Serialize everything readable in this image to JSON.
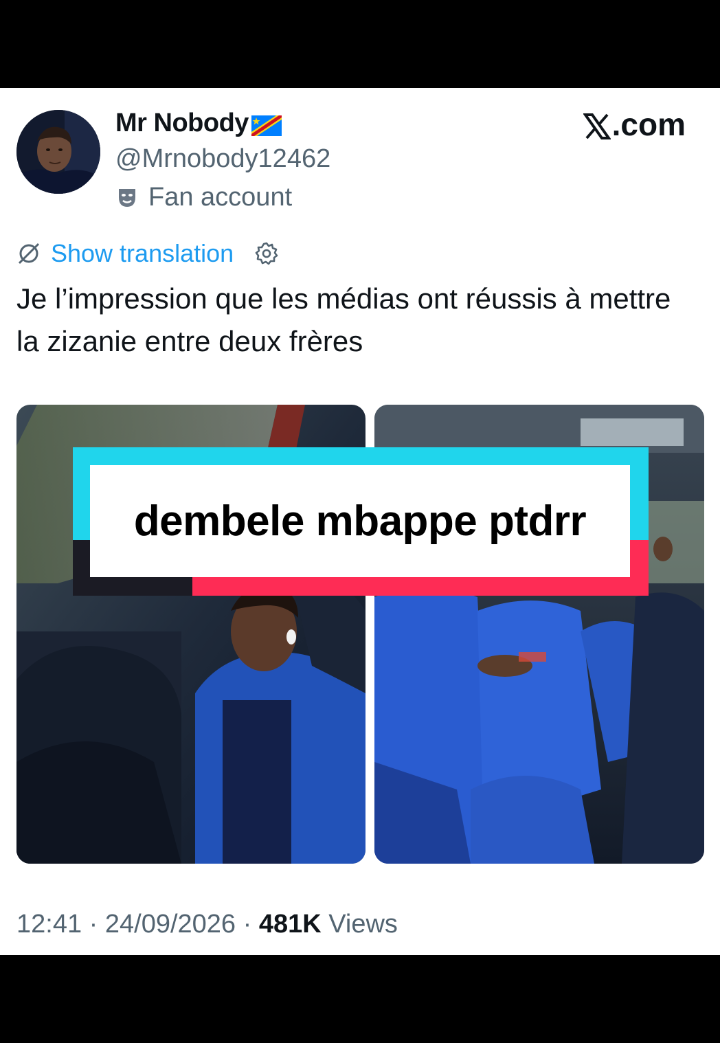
{
  "tweet": {
    "display_name": "Mr Nobody",
    "flag": "drc-flag",
    "handle": "@Mrnobody12462",
    "affiliation": "Fan account",
    "affiliation_icon": "theater-mask-icon",
    "brand": ".com",
    "brand_logo": "x-logo",
    "translate_label": "Show translation",
    "text": "Je l’impression que les médias ont réussis à mettre la zizanie entre deux frères",
    "time": "12:41",
    "date": "24/09/2026",
    "views_count": "481K",
    "views_label": "Views"
  },
  "overlay": {
    "caption": "dembele mbappe ptdrr"
  },
  "colors": {
    "accent": "#1d9bf0",
    "secondary_text": "#536471",
    "primary_text": "#0f1419",
    "overlay_cyan": "#20d5ec",
    "overlay_pink": "#fe2c55"
  }
}
